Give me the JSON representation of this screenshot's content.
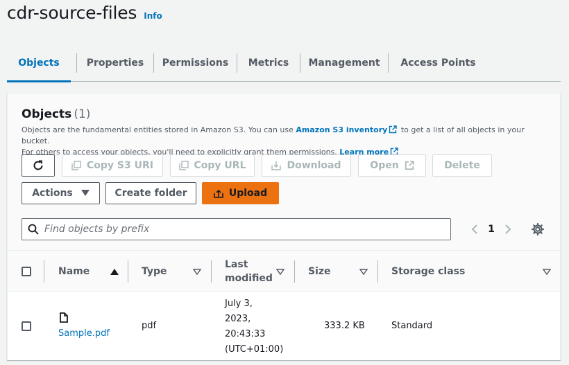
{
  "bucket": {
    "title": "cdr-source-files",
    "info_label": "Info"
  },
  "tabs": [
    {
      "label": "Objects",
      "active": true
    },
    {
      "label": "Properties"
    },
    {
      "label": "Permissions"
    },
    {
      "label": "Metrics"
    },
    {
      "label": "Management"
    },
    {
      "label": "Access Points"
    }
  ],
  "objects": {
    "heading": "Objects",
    "count": "(1)",
    "desc_part1": "Objects are the fundamental entities stored in Amazon S3. You can use",
    "inventory_link": "Amazon S3 inventory",
    "desc_part2": "to get a list of all objects in your bucket.",
    "desc_part3": "For others to access your objects, you'll need to explicitly grant them permissions.",
    "learn_more": "Learn more"
  },
  "toolbar": {
    "copy_s3_uri": "Copy S3 URI",
    "copy_url": "Copy URL",
    "download": "Download",
    "open": "Open",
    "delete": "Delete",
    "actions": "Actions",
    "create_folder": "Create folder",
    "upload": "Upload"
  },
  "search": {
    "placeholder": "Find objects by prefix"
  },
  "pagination": {
    "current_page": "1"
  },
  "table": {
    "columns": {
      "name": "Name",
      "type": "Type",
      "last_modified_1": "Last",
      "last_modified_2": "modified",
      "size": "Size",
      "storage_class": "Storage class"
    },
    "rows": [
      {
        "name": "Sample.pdf",
        "type": "pdf",
        "modified_lines": [
          "July 3,",
          "2023,",
          "20:43:33",
          "(UTC+01:00)"
        ],
        "size": "333.2 KB",
        "storage_class": "Standard"
      }
    ]
  },
  "colors": {
    "link": "#0073bb",
    "primary": "#ec7211",
    "text": "#16191f",
    "muted": "#545b64",
    "disabled": "#aab7b8"
  },
  "icons": [
    "refresh-icon",
    "copy-icon",
    "download-icon",
    "external-link-icon",
    "caret-down-icon",
    "upload-icon",
    "search-icon",
    "chevron-left-icon",
    "chevron-right-icon",
    "gear-icon",
    "sort-up-icon",
    "sort-down-icon",
    "file-icon"
  ]
}
